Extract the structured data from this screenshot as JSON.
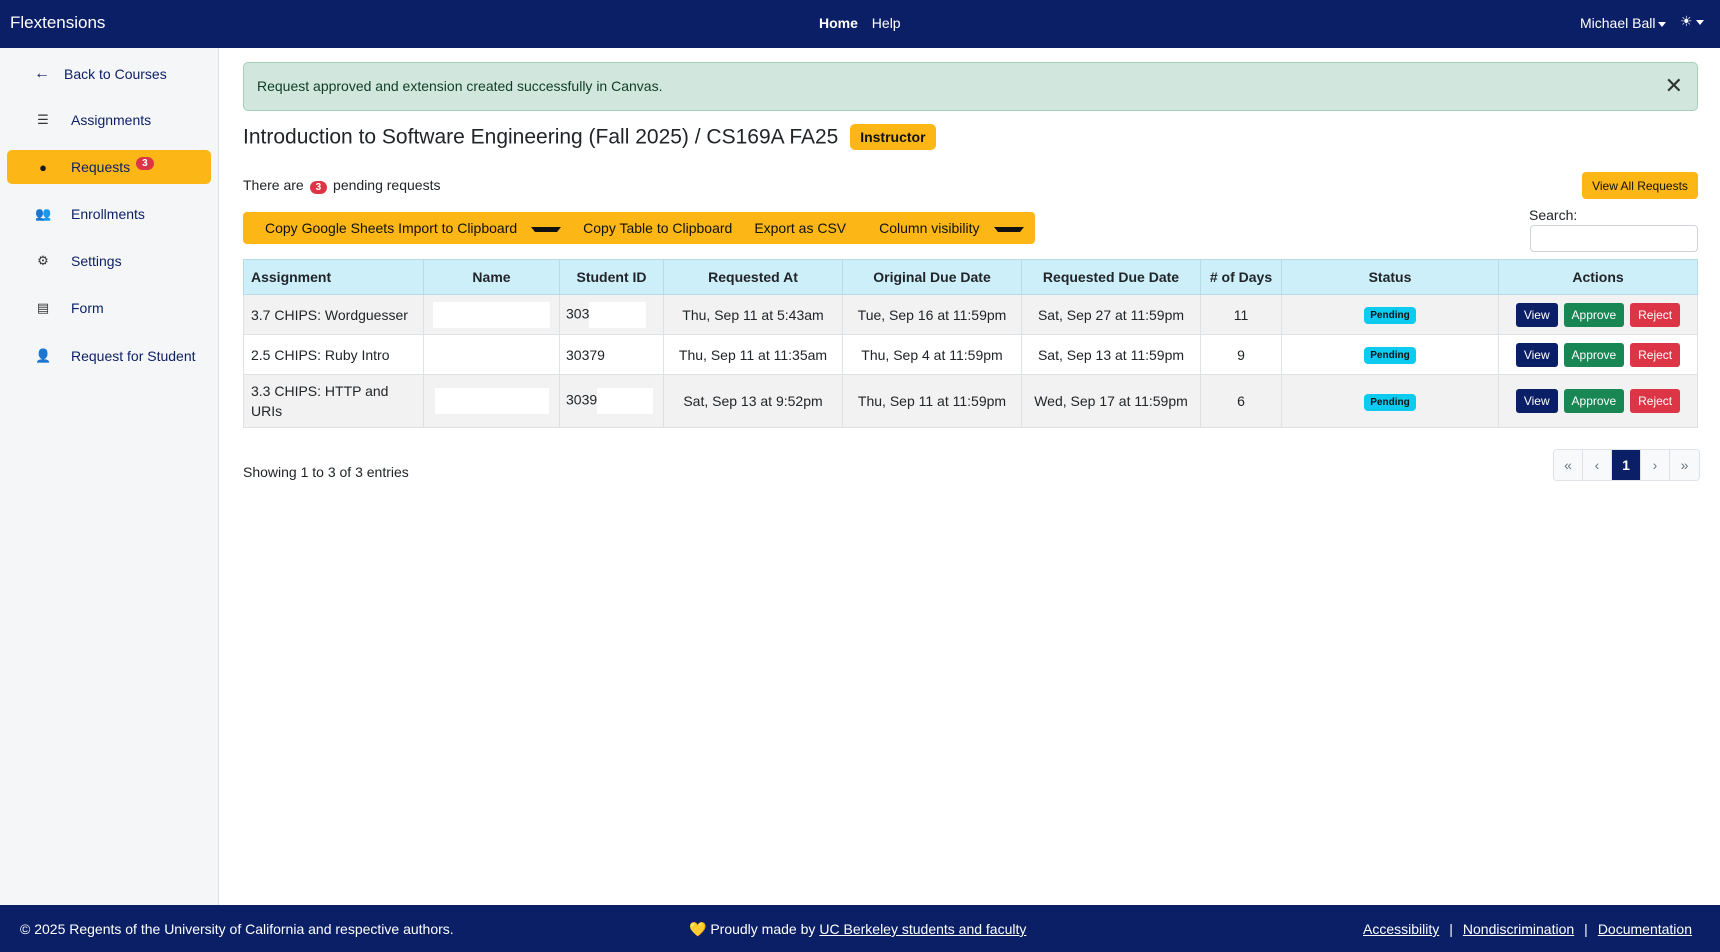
{
  "app": {
    "brand": "Flextensions"
  },
  "topnav": {
    "home": "Home",
    "help": "Help",
    "user": "Michael Ball",
    "theme_icon": "sun-icon"
  },
  "sidebar": {
    "back": "Back to Courses",
    "items": [
      {
        "label": "Assignments",
        "icon": "list-check-icon"
      },
      {
        "label": "Requests",
        "icon": "clock-icon",
        "badge": "3"
      },
      {
        "label": "Enrollments",
        "icon": "users-icon"
      },
      {
        "label": "Settings",
        "icon": "gear-icon"
      },
      {
        "label": "Form",
        "icon": "file-icon"
      },
      {
        "label": "Request for Student",
        "icon": "user-plus-icon"
      }
    ]
  },
  "alert": {
    "message": "Request approved and extension created successfully in Canvas."
  },
  "page": {
    "title": "Introduction to Software Engineering (Fall 2025) / CS169A FA25",
    "role": "Instructor",
    "pending_prefix": "There are",
    "pending_count": "3",
    "pending_suffix": "pending requests",
    "view_all": "View All Requests"
  },
  "toolbar": {
    "sheets": "Copy Google Sheets Import to Clipboard",
    "copy_table": "Copy Table to Clipboard",
    "export_csv": "Export as CSV",
    "columns": "Column visibility"
  },
  "search": {
    "label": "Search:",
    "value": "",
    "placeholder": ""
  },
  "table": {
    "headers": [
      "Assignment",
      "Name",
      "Student ID",
      "Requested At",
      "Original Due Date",
      "Requested Due Date",
      "# of Days",
      "Status",
      "Actions"
    ],
    "rows": [
      {
        "assignment": "3.7 CHIPS: Wordguesser",
        "name": "",
        "student_id": "303",
        "requested_at": "Thu, Sep 11 at 5:43am",
        "original_due": "Tue, Sep 16 at 11:59pm",
        "requested_due": "Sat, Sep 27 at 11:59pm",
        "days": "11",
        "status": "Pending"
      },
      {
        "assignment": "2.5 CHIPS: Ruby Intro",
        "name": "",
        "student_id": "30379",
        "requested_at": "Thu, Sep 11 at 11:35am",
        "original_due": "Thu, Sep 4 at 11:59pm",
        "requested_due": "Sat, Sep 13 at 11:59pm",
        "days": "9",
        "status": "Pending"
      },
      {
        "assignment": "3.3 CHIPS: HTTP and URIs",
        "name": "",
        "student_id": "3039",
        "requested_at": "Sat, Sep 13 at 9:52pm",
        "original_due": "Thu, Sep 11 at 11:59pm",
        "requested_due": "Wed, Sep 17 at 11:59pm",
        "days": "6",
        "status": "Pending"
      }
    ],
    "actions": {
      "view": "View",
      "approve": "Approve",
      "reject": "Reject"
    }
  },
  "pagination": {
    "info": "Showing 1 to 3 of 3 entries",
    "first": "«",
    "prev": "‹",
    "current": "1",
    "next": "›",
    "last": "»"
  },
  "footer": {
    "copyright": "© 2025 Regents of the University of California and respective authors.",
    "made_prefix": "💛 Proudly made by",
    "made_link": "UC Berkeley students and faculty",
    "accessibility": "Accessibility",
    "nondiscrimination": "Nondiscrimination",
    "documentation": "Documentation",
    "separator": "|"
  },
  "colors": {
    "navy": "#0b1f66",
    "gold": "#fcb616",
    "success_bg": "#d1e7dd",
    "danger": "#dc3545",
    "info": "#0dcaf0"
  }
}
